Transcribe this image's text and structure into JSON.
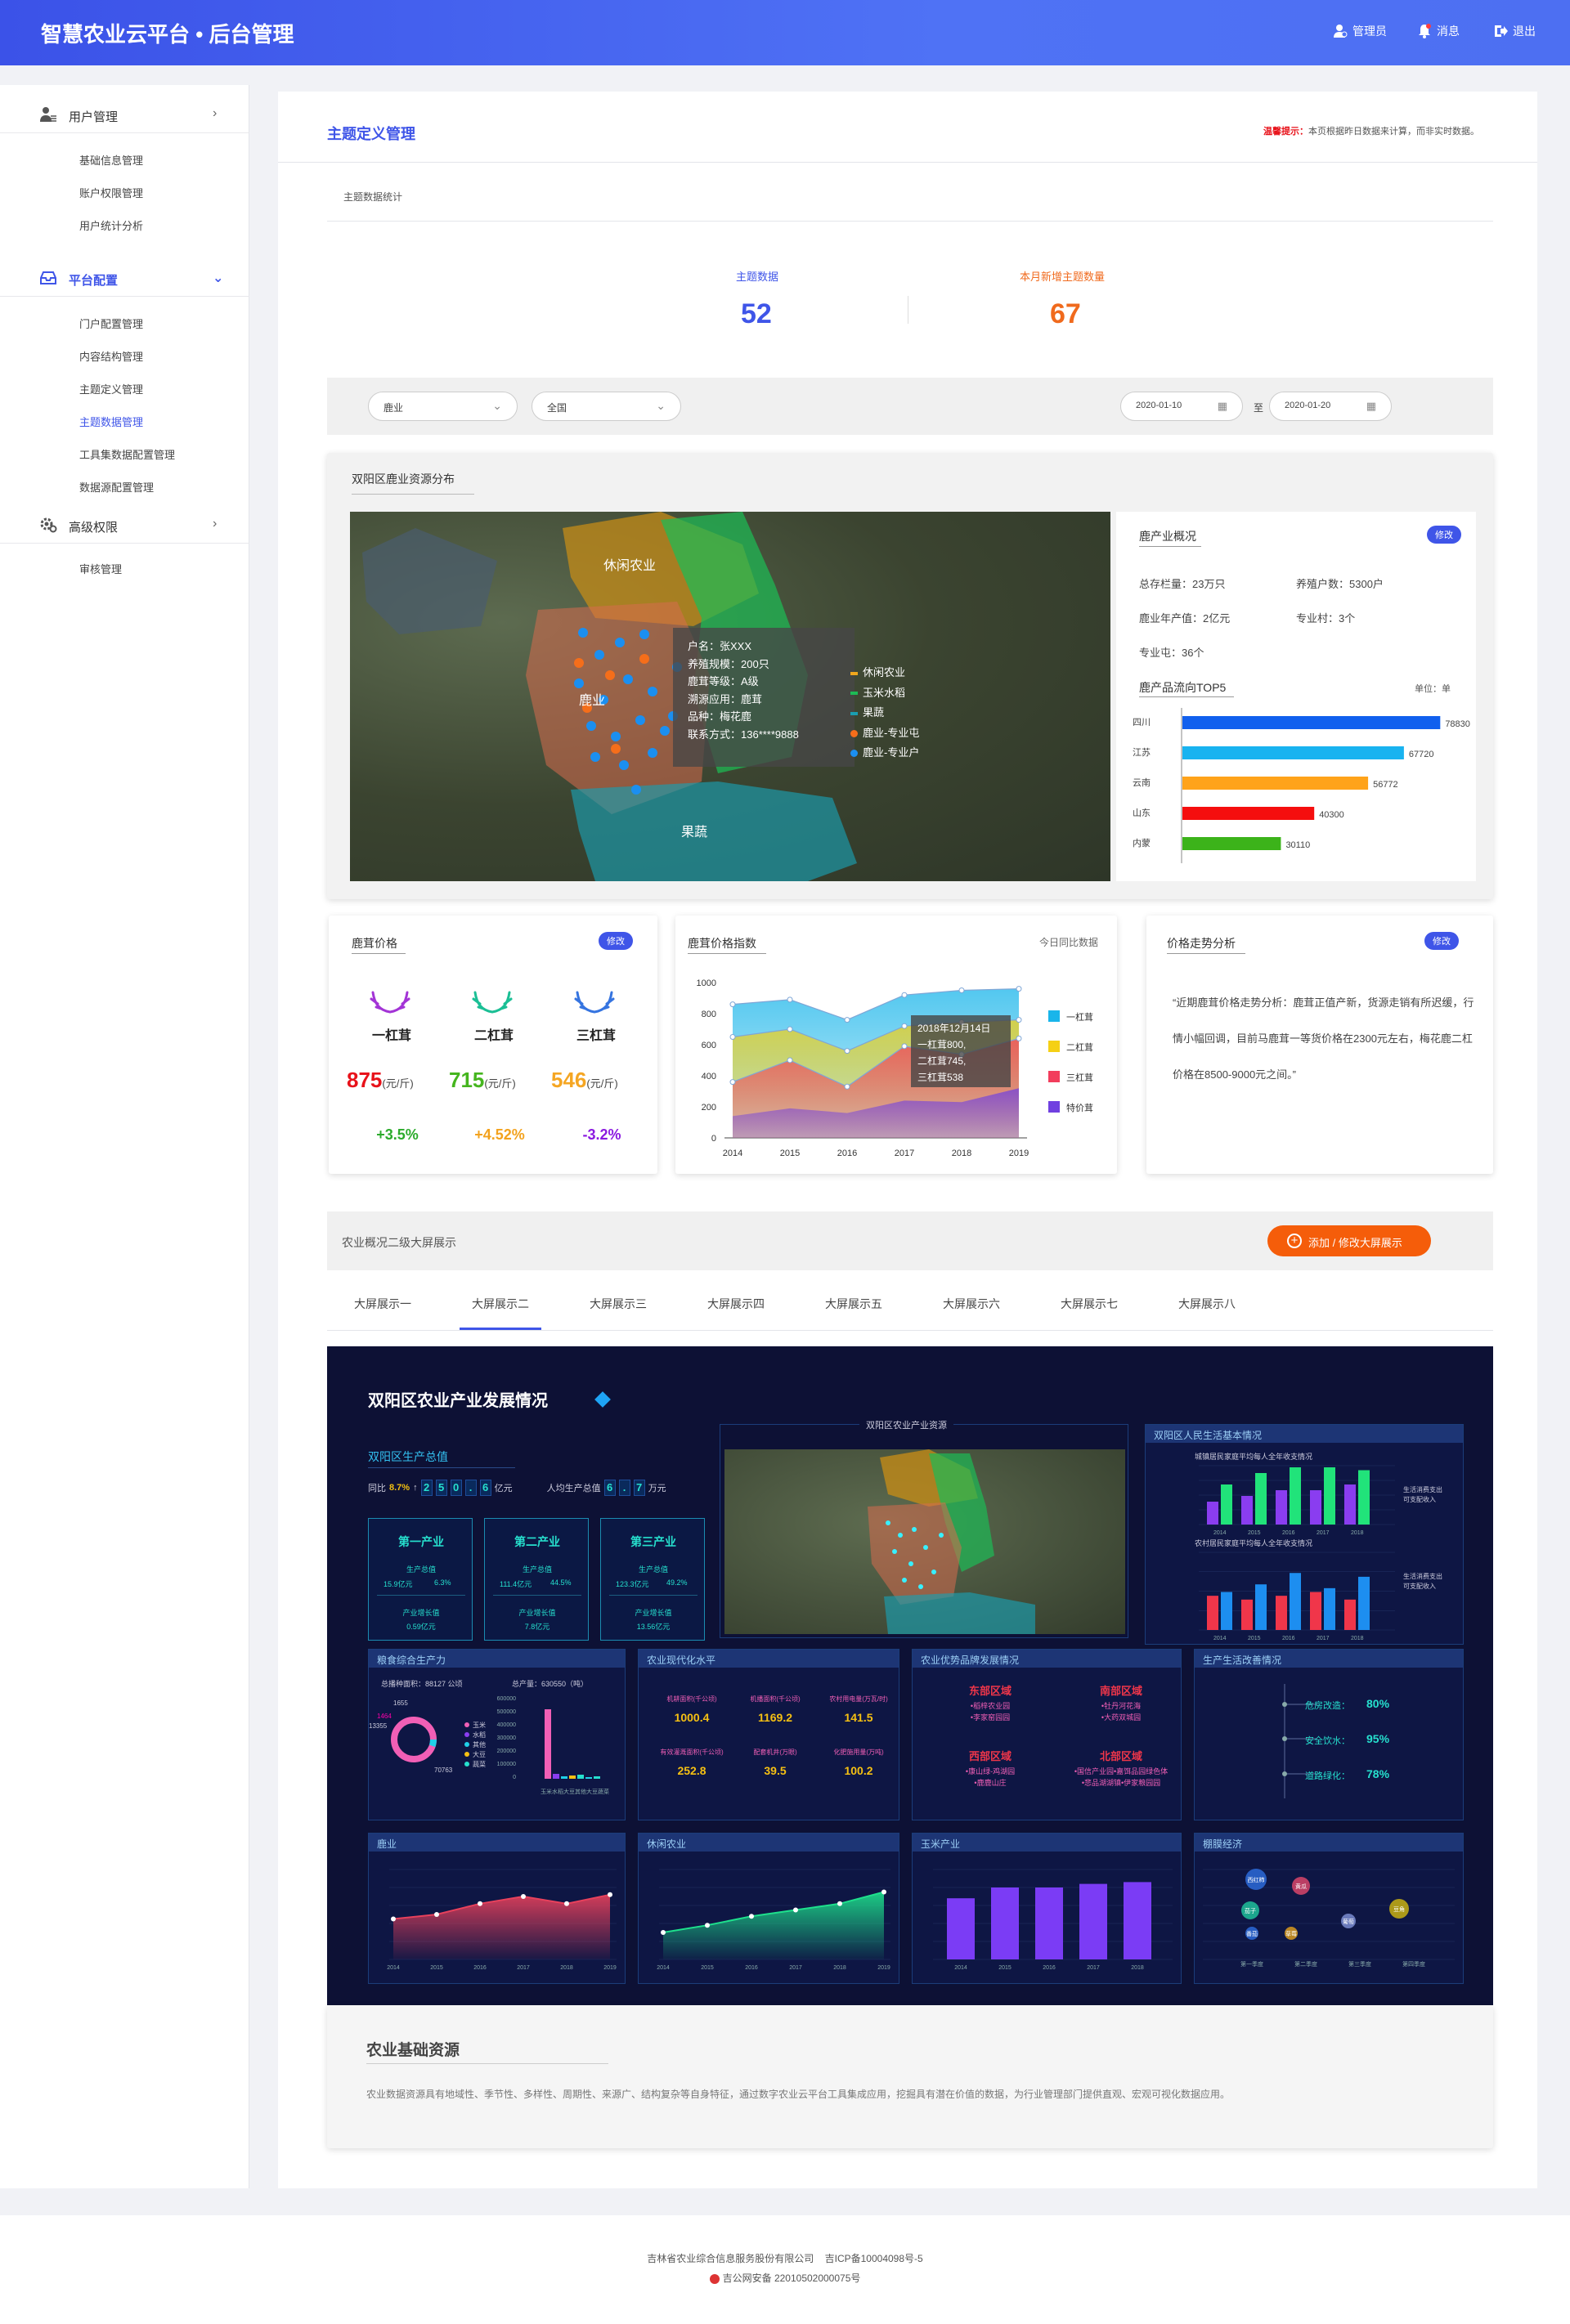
{
  "header": {
    "title": "智慧农业云平台 • 后台管理",
    "admin": "管理员",
    "messages": "消息",
    "logout": "退出"
  },
  "sidebar": {
    "groups": [
      {
        "label": "用户管理",
        "items": [
          "基础信息管理",
          "账户权限管理",
          "用户统计分析"
        ]
      },
      {
        "label": "平台配置",
        "items": [
          "门户配置管理",
          "内容结构管理",
          "主题定义管理",
          "主题数据管理",
          "工具集数据配置管理",
          "数据源配置管理"
        ]
      },
      {
        "label": "高级权限",
        "items": [
          "审核管理"
        ]
      }
    ]
  },
  "page": {
    "title": "主题定义管理",
    "tip_label": "温馨提示：",
    "tip_text": "本页根据昨日数据来计算，而非实时数据。",
    "section_label": "主题数据统计"
  },
  "stats": {
    "theme_label": "主题数据",
    "theme_value": "52",
    "new_label": "本月新增主题数量",
    "new_value": "67"
  },
  "filters": {
    "category": "鹿业",
    "region": "全国",
    "date_from": "2020-01-10",
    "date_to": "2020-01-20",
    "to_label": "至"
  },
  "map_section": {
    "title": "双阳区鹿业资源分布",
    "labels": [
      "休闲农业",
      "鹿业",
      "果蔬"
    ],
    "tooltip": [
      "户名：张XXX",
      "养殖规模：200只",
      "鹿茸等级：A级",
      "溯源应用：鹿茸",
      "品种：梅花鹿",
      "联系方式：136****9888"
    ],
    "legend": [
      "休闲农业",
      "玉米水稻",
      "果蔬",
      "鹿业-专业屯",
      "鹿业-专业户"
    ],
    "overview_title": "鹿产业概况",
    "edit": "修改",
    "stats": [
      {
        "label": "总存栏量：",
        "value": "23万只"
      },
      {
        "label": "养殖户数：",
        "value": "5300户"
      },
      {
        "label": "鹿业年产值：",
        "value": "2亿元"
      },
      {
        "label": "专业村：",
        "value": "3个"
      },
      {
        "label": "专业屯：",
        "value": "36个"
      }
    ],
    "top5_title": "鹿产品流向TOP5",
    "unit_label": "单位：单",
    "top5": [
      {
        "name": "四川",
        "value": 78830,
        "color": "#1160ee"
      },
      {
        "name": "江苏",
        "value": 67720,
        "color": "#18b3f0"
      },
      {
        "name": "云南",
        "value": 56772,
        "color": "#ffa31a"
      },
      {
        "name": "山东",
        "value": 40300,
        "color": "#f50e0e"
      },
      {
        "name": "内蒙",
        "value": 30110,
        "color": "#3cb31a"
      }
    ]
  },
  "price_card": {
    "title": "鹿茸价格",
    "edit": "修改",
    "unit": "(元/斤)",
    "items": [
      {
        "name": "一杠茸",
        "price": "875",
        "change": "+3.5%",
        "price_color": "#e8121a",
        "change_color": "#2cab2c",
        "antler_color": "#a334d6"
      },
      {
        "name": "二杠茸",
        "price": "715",
        "change": "+4.52%",
        "price_color": "#45b51e",
        "change_color": "#f3a21d",
        "antler_color": "#1bbf95"
      },
      {
        "name": "三杠茸",
        "price": "546",
        "change": "-3.2%",
        "price_color": "#f5a623",
        "change_color": "#8b1ae0",
        "antler_color": "#3574e0"
      }
    ]
  },
  "index_card": {
    "title": "鹿茸价格指数",
    "note": "今日同比数据"
  },
  "chart_data": {
    "type": "area",
    "x": [
      2014,
      2015,
      2016,
      2017,
      2018,
      2019
    ],
    "ylim": [
      0,
      1000
    ],
    "yticks": [
      0,
      200,
      400,
      600,
      800,
      1000
    ],
    "series": [
      {
        "name": "一杠茸",
        "color": "#19b5ea",
        "values": [
          860,
          890,
          760,
          920,
          950,
          960
        ]
      },
      {
        "name": "二杠茸",
        "color": "#f5d015",
        "values": [
          650,
          700,
          560,
          720,
          745,
          760
        ]
      },
      {
        "name": "三杠茸",
        "color": "#f23d5c",
        "values": [
          360,
          500,
          330,
          590,
          538,
          640
        ]
      },
      {
        "name": "特价茸",
        "color": "#7040e0",
        "values": [
          140,
          190,
          160,
          240,
          230,
          320
        ]
      }
    ],
    "tooltip": [
      "2018年12月14日",
      "一杠茸800,",
      "二杠茸745,",
      "三杠茸538"
    ]
  },
  "trend_card": {
    "title": "价格走势分析",
    "edit": "修改",
    "text": "“近期鹿茸价格走势分析：鹿茸正值产新，货源走销有所迟缓，行情小幅回调，目前马鹿茸一等货价格在2300元左右，梅花鹿二杠价格在8500-9000元之间。”"
  },
  "screen_section": {
    "title": "农业概况二级大屏展示",
    "add_button": "添加 / 修改大屏展示",
    "tabs": [
      "大屏展示一",
      "大屏展示二",
      "大屏展示三",
      "大屏展示四",
      "大屏展示五",
      "大屏展示六",
      "大屏展示七",
      "大屏展示八"
    ],
    "active_tab": 1
  },
  "dashboard": {
    "title": "双阳区农业产业发展情况",
    "map_title": "双阳区农业产业资源",
    "gdp": {
      "title": "双阳区生产总值",
      "yoy_label": "同比",
      "yoy": "8.7%",
      "digits": "250.6",
      "unit": "亿元",
      "per_label": "人均生产总值",
      "per_digits": "6.7",
      "per_unit": "万元"
    },
    "industries": [
      {
        "name": "第一产业",
        "a_label": "生产总值",
        "a1": "15.9亿元",
        "a2": "6.3%",
        "b_label": "产业增长值",
        "b": "0.59亿元"
      },
      {
        "name": "第二产业",
        "a_label": "生产总值",
        "a1": "111.4亿元",
        "a2": "44.5%",
        "b_label": "产业增长值",
        "b": "7.8亿元"
      },
      {
        "name": "第三产业",
        "a_label": "生产总值",
        "a1": "123.3亿元",
        "a2": "49.2%",
        "b_label": "产业增长值",
        "b": "13.56亿元"
      }
    ],
    "life": {
      "title": "双阳区人民生活基本情况",
      "c1": "城镇居民家庭平均每人全年收支情况",
      "c2": "农村居民家庭平均每人全年收支情况",
      "leg1": "生活消费支出",
      "leg2": "可支配收入"
    },
    "grain": {
      "title": "粮食综合生产力",
      "area_label": "总播种面积：",
      "area": "88127 公顷",
      "prod_label": "总产量：",
      "prod": "630550（吨）",
      "pie_labels": [
        "1655",
        "1464",
        "13355",
        "70763"
      ],
      "legend": [
        "玉米",
        "水稻",
        "其他",
        "大豆",
        "蔬菜"
      ],
      "note": "玉米水稻大豆其他大豆蔬菜"
    },
    "modern": {
      "title": "农业现代化水平",
      "items": [
        {
          "label": "机耕面积(千公顷)",
          "value": "1000.4"
        },
        {
          "label": "机播面积(千公顷)",
          "value": "1169.2"
        },
        {
          "label": "农村用电量(万瓦/时)",
          "value": "141.5"
        },
        {
          "label": "有效灌溉面积(千公顷)",
          "value": "252.8"
        },
        {
          "label": "配套机井(万眼)",
          "value": "39.5"
        },
        {
          "label": "化肥施用量(万吨)",
          "value": "100.2"
        }
      ]
    },
    "brand": {
      "title": "农业优势品牌发展情况",
      "regions": [
        {
          "name": "东部区域",
          "items": [
            "•稻梓农业园",
            "•李家窑园园"
          ]
        },
        {
          "name": "南部区域",
          "items": [
            "•牡丹河花海",
            "•大药双城园"
          ]
        },
        {
          "name": "西部区域",
          "items": [
            "•康山绿-鸡湖园",
            "•鹿鹿山庄"
          ]
        },
        {
          "name": "北部区域",
          "items": [
            "•国信产业园•嘉饵品园绿色体",
            "•悲品湖湖镇•伊家粮园园"
          ]
        }
      ]
    },
    "env": {
      "title": "生产生活改善情况",
      "items": [
        {
          "label": "危房改造：",
          "value": "80%"
        },
        {
          "label": "安全饮水：",
          "value": "95%"
        },
        {
          "label": "道路绿化：",
          "value": "78%"
        }
      ]
    },
    "p1": {
      "title": "鹿业"
    },
    "p2": {
      "title": "休闲农业"
    },
    "p3": {
      "title": "玉米产业"
    },
    "p4": {
      "title": "棚膜经济",
      "bubbles": [
        "西红柿",
        "黄瓜",
        "茄子",
        "豆角",
        "番茄",
        "草莓",
        "葡萄"
      ],
      "quarters": [
        "第一季度",
        "第二季度",
        "第三季度",
        "第四季度"
      ]
    },
    "years": [
      "2014",
      "2015",
      "2016",
      "2017",
      "2018",
      "2019"
    ]
  },
  "resource": {
    "title": "农业基础资源",
    "text": "农业数据资源具有地域性、季节性、多样性、周期性、来源广、结构复杂等自身特征，通过数字农业云平台工具集成应用，挖掘具有潜在价值的数据，为行业管理部门提供直观、宏观可视化数据应用。"
  },
  "footer": {
    "line1": "吉林省农业综合信息服务股份有限公司    吉ICP备10004098号-5",
    "line2": "吉公网安备 22010502000075号"
  }
}
